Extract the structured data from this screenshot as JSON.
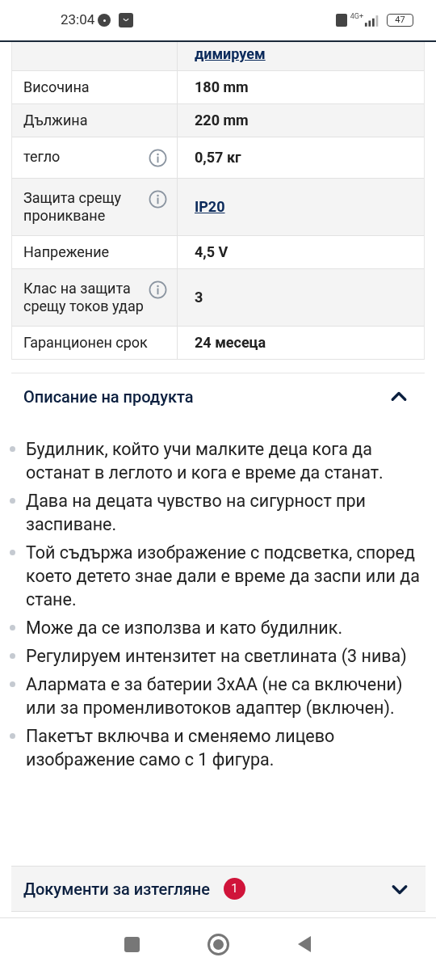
{
  "status_bar": {
    "time": "23:04",
    "network": "4G+",
    "battery": "47"
  },
  "specs": [
    {
      "value": "димируем",
      "info": false,
      "link": true
    },
    {
      "label": "Височина",
      "value": "180 mm",
      "info": false,
      "link": false
    },
    {
      "label": "Дължина",
      "value": "220 mm",
      "info": false,
      "link": false
    },
    {
      "label": "тегло",
      "value": "0,57 кг",
      "info": true,
      "link": false
    },
    {
      "label": "Защита срещу проникване",
      "value": "IP20",
      "info": true,
      "link": true
    },
    {
      "label": "Напрежение",
      "value": "4,5 V",
      "info": false,
      "link": false
    },
    {
      "label": "Клас на защита срещу токов удар",
      "value": "3",
      "info": true,
      "link": false
    },
    {
      "label": "Гаранционен срок",
      "value": "24 месеца",
      "info": false,
      "link": false
    }
  ],
  "description": {
    "title": "Описание на продукта",
    "expanded": true,
    "bullets": [
      "Будилник, който учи малките деца кога да останат в леглото и кога е време да станат.",
      "Дава на децата чувство на сигурност при заспиване.",
      "Той съдържа изображение с подсветка, според което детето знае дали е време да заспи или да стане.",
      "Може да се използва и като будилник.",
      "Регулируем интензитет на светлината (3 нива)",
      "Алармата е за батерии 3xAA (не са включени) или за променливотоков адаптер (включен).",
      "Пакетът включва и сменяемо лицево изображение само с 1 фигура."
    ]
  },
  "documents": {
    "title": "Документи за изтегляне",
    "badge": "1",
    "expanded": false
  }
}
